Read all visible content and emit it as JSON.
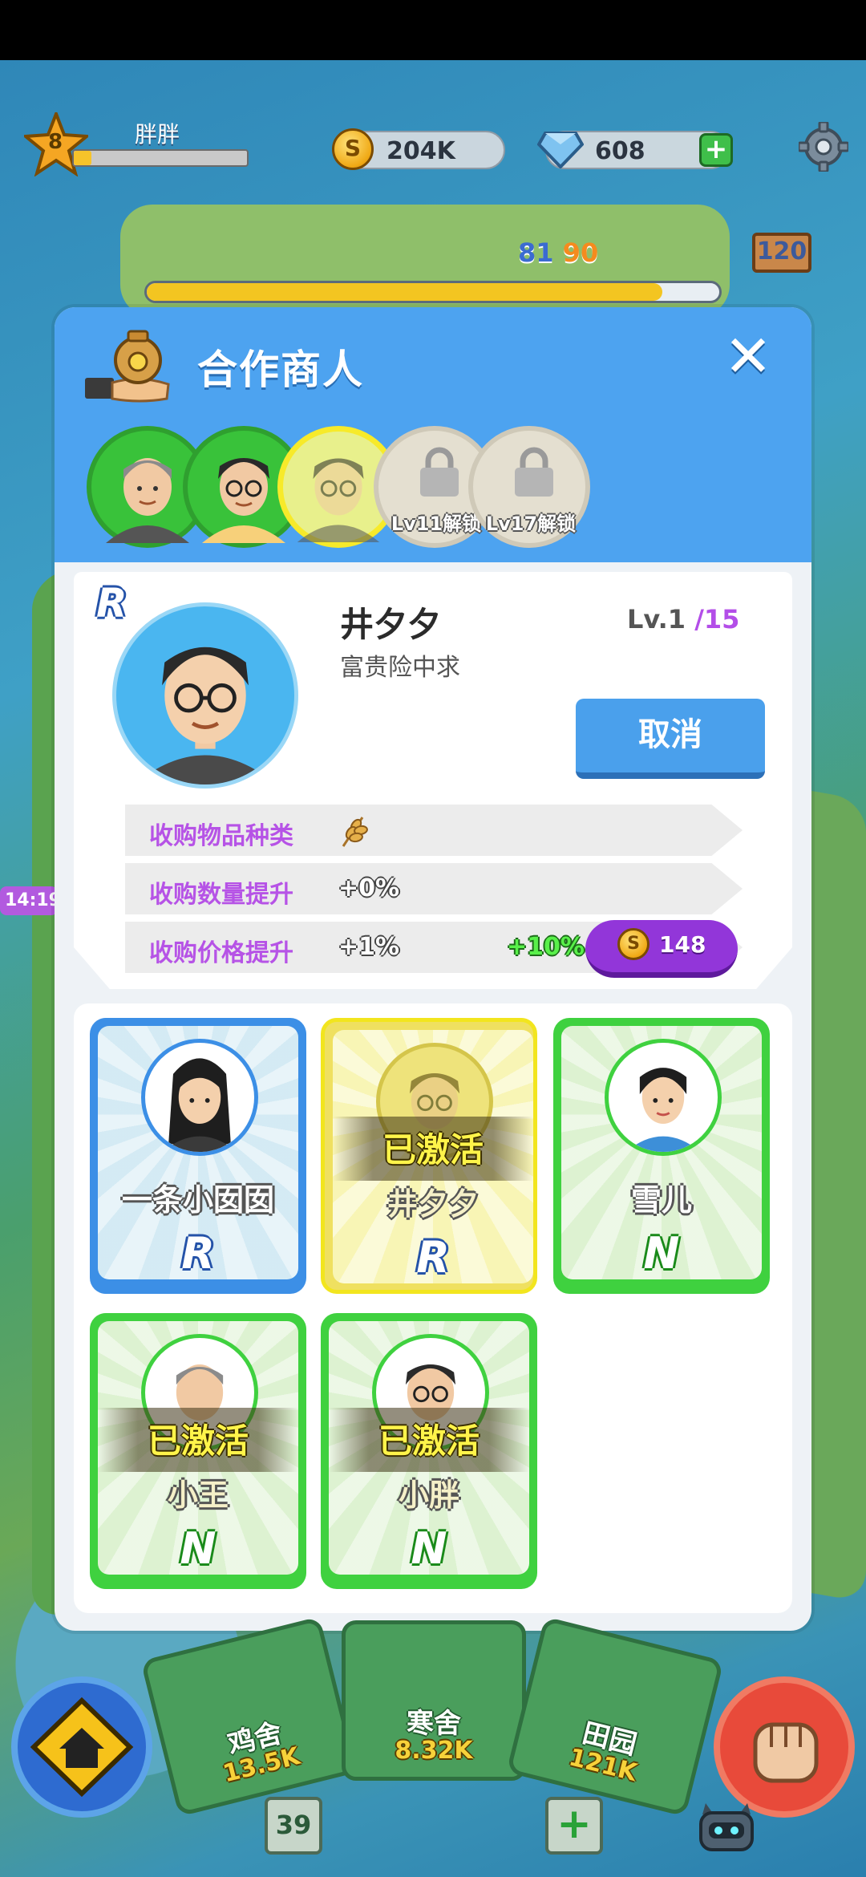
{
  "hud": {
    "level": "8",
    "player_name": "胖胖",
    "xp_progress": 0.1,
    "coins": "204K",
    "gems": "608",
    "village_progress_current": "81",
    "village_progress_target": "90",
    "village_progress_fraction": 0.9,
    "signpost_value": "120"
  },
  "modal": {
    "title": "合作商人",
    "tabs": [
      {
        "state": "unlocked"
      },
      {
        "state": "unlocked"
      },
      {
        "state": "selected"
      },
      {
        "state": "locked",
        "label": "Lv11解锁"
      },
      {
        "state": "locked",
        "label": "Lv17解锁"
      }
    ],
    "detail": {
      "rarity": "R",
      "name": "井夕夕",
      "description": "富贵险中求",
      "level_prefix": "Lv.1",
      "level_max": "/15",
      "cancel_label": "取消",
      "stats": [
        {
          "label": "收购物品种类",
          "value": ""
        },
        {
          "label": "收购数量提升",
          "value": "+0%"
        },
        {
          "label": "收购价格提升",
          "value": "+1%",
          "bonus": "+10%"
        }
      ],
      "upgrade_cost": "148"
    },
    "active_label": "已激活",
    "cards": [
      {
        "name": "一条小囡囡",
        "rarity": "R"
      },
      {
        "name": "井夕夕",
        "rarity": "R"
      },
      {
        "name": "雪儿",
        "rarity": "N"
      },
      {
        "name": "小王",
        "rarity": "N"
      },
      {
        "name": "小胖",
        "rarity": "N"
      }
    ]
  },
  "bottom": {
    "buildings": [
      {
        "name": "鸡舍",
        "cost": "13.5K"
      },
      {
        "name": "寒舍",
        "cost": "8.32K"
      },
      {
        "name": "田园",
        "cost": "121K"
      }
    ],
    "card_count": "39",
    "side_timer": "14:19"
  },
  "colors": {
    "header_blue": "#4da3f0",
    "rarity_r": "#2452a8",
    "rarity_n": "#3fd13f",
    "accent_purple": "#9236d9",
    "active_yellow": "#fff44a"
  }
}
